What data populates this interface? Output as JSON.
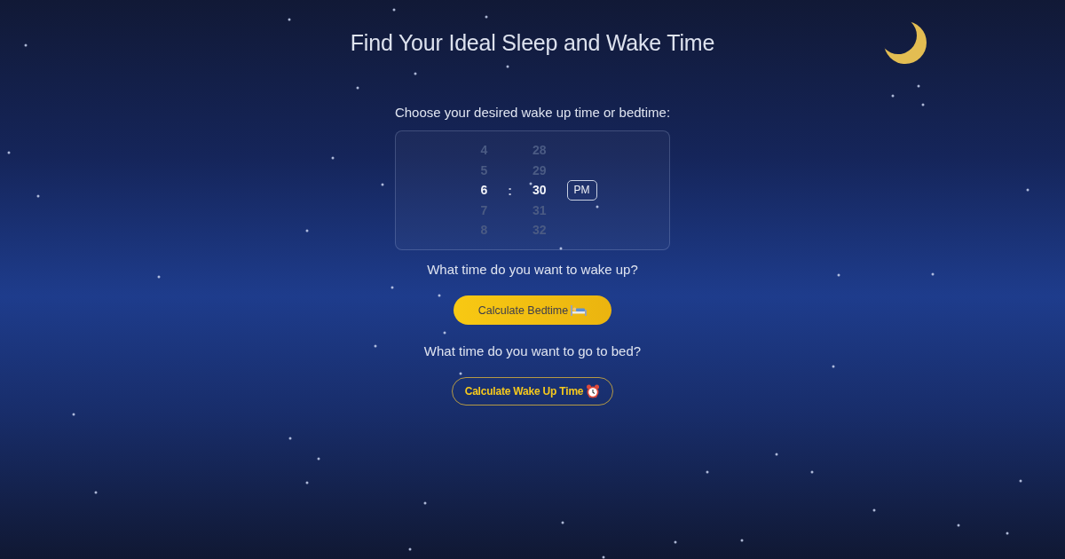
{
  "header": {
    "title": "Find Your Ideal Sleep and Wake Time"
  },
  "picker": {
    "label": "Choose your desired wake up time or bedtime:",
    "hours": [
      {
        "label": "4",
        "selected": false
      },
      {
        "label": "5",
        "selected": false
      },
      {
        "label": "6",
        "selected": true
      },
      {
        "label": "7",
        "selected": false
      },
      {
        "label": "8",
        "selected": false
      }
    ],
    "separator": ":",
    "minutes": [
      {
        "label": "28",
        "selected": false
      },
      {
        "label": "29",
        "selected": false
      },
      {
        "label": "30",
        "selected": true
      },
      {
        "label": "31",
        "selected": false
      },
      {
        "label": "32",
        "selected": false
      }
    ],
    "period": "PM"
  },
  "actions": [
    {
      "question": "What time do you want to wake up?",
      "button": {
        "label": "Calculate Bedtime",
        "kind": "primary"
      }
    },
    {
      "question": "What time do you want to go to bed?",
      "button": {
        "label": "Calculate Wake Up Time",
        "kind": "secondary"
      }
    }
  ]
}
